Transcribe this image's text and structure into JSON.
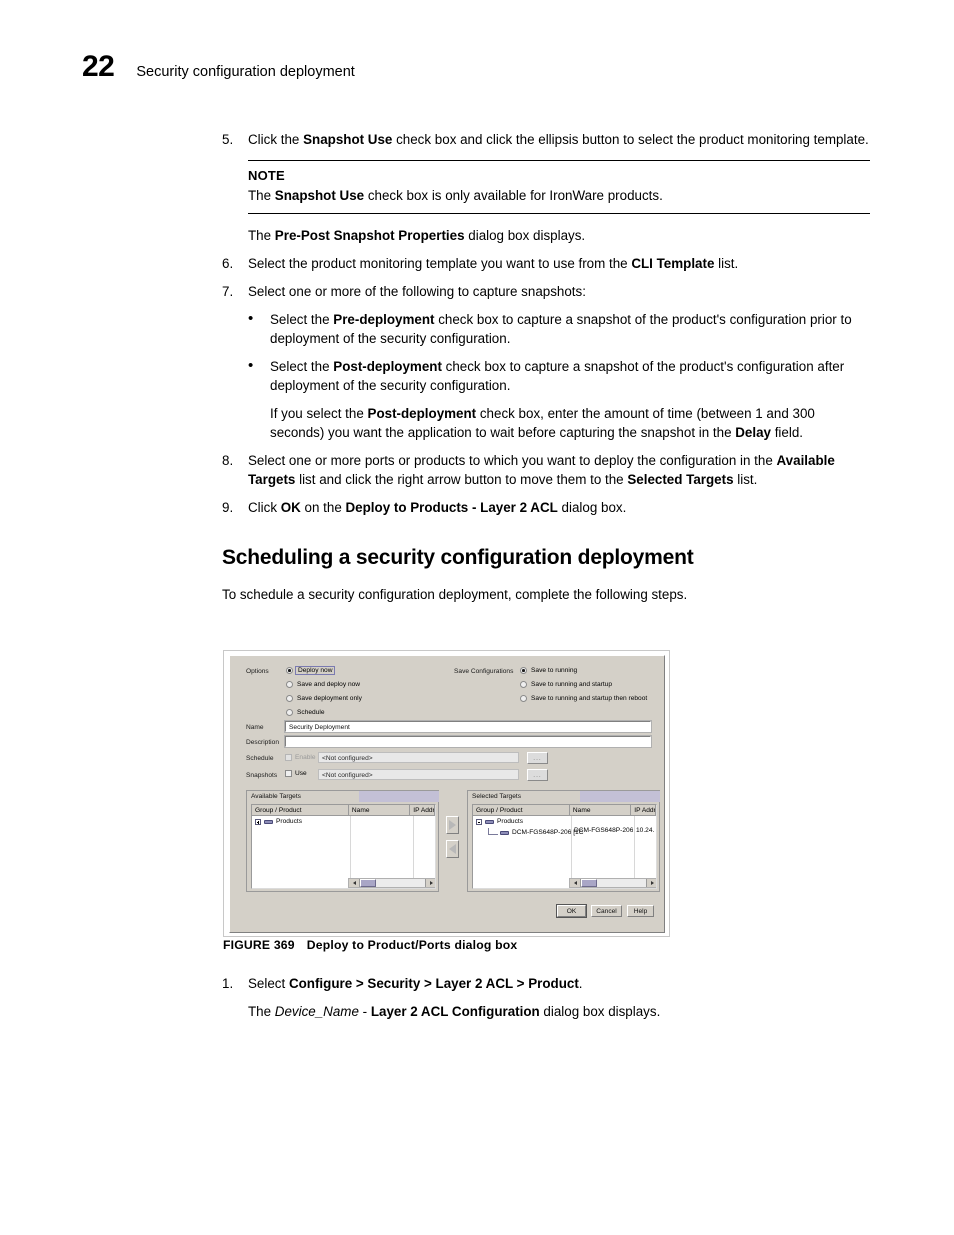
{
  "page": {
    "number": "22",
    "chapter_title": "Security configuration deployment"
  },
  "steps": [
    {
      "num": "5.",
      "text_parts": [
        "Click the ",
        "Snapshot Use",
        " check box and click the ellipsis button to select the product monitoring template."
      ]
    }
  ],
  "step5": {
    "num": "5.",
    "pre": "Click the ",
    "bold": "Snapshot Use",
    "post": " check box and click the ellipsis button to select the product monitoring template."
  },
  "note": {
    "title": "NOTE",
    "pre": "The ",
    "bold": "Snapshot Use",
    "post": " check box is only available for IronWare products."
  },
  "after_note": {
    "pre": "The ",
    "bold": "Pre-Post Snapshot Properties",
    "post": " dialog box displays."
  },
  "step6": {
    "num": "6.",
    "pre": "Select the product monitoring template you want to use from the ",
    "bold": "CLI Template",
    "post": " list."
  },
  "step7": {
    "num": "7.",
    "text": "Select one or more of the following to capture snapshots:"
  },
  "bullet1": {
    "dot": "•",
    "pre": "Select the ",
    "bold": "Pre-deployment",
    "post": " check box to capture a snapshot of the product's configuration prior to deployment of the security configuration."
  },
  "bullet2": {
    "dot": "•",
    "pre": "Select the ",
    "bold": "Post-deployment",
    "post": " check box to capture a snapshot of the product's configuration after deployment of the security configuration."
  },
  "bullet2_sub": {
    "pre": "If you select the ",
    "bold1": "Post-deployment",
    "mid": " check box, enter the amount of time (between 1 and 300 seconds) you want the application to wait before capturing the snapshot in the ",
    "bold2": "Delay",
    "post": " field."
  },
  "step8": {
    "num": "8.",
    "pre": "Select one or more ports or products to which you want to deploy the configuration in the ",
    "bold1": "Available Targets",
    "mid": " list and click the right arrow button to move them to the ",
    "bold2": "Selected Targets",
    "post": " list."
  },
  "step9": {
    "num": "9.",
    "pre": "Click ",
    "bold1": "OK",
    "mid": " on the ",
    "bold2": "Deploy to Products - Layer 2 ACL",
    "post": " dialog box."
  },
  "section": {
    "heading": "Scheduling a security configuration deployment",
    "intro": "To schedule a security configuration deployment, complete the following steps."
  },
  "figure": {
    "label": "FIGURE 369",
    "caption": "Deploy to Product/Ports dialog box"
  },
  "trailing_step1": {
    "num": "1.",
    "pre": "Select ",
    "bold": "Configure > Security > Layer 2 ACL > Product",
    "post": "."
  },
  "trailing_sub": {
    "pre": "The ",
    "italic": "Device_Name",
    "mid": " - ",
    "bold": "Layer 2 ACL Configuration",
    "post": " dialog box displays."
  },
  "dialog": {
    "options_label": "Options",
    "save_config_label": "Save Configurations",
    "options_radios": [
      {
        "label": "Deploy now",
        "selected": true,
        "focused": true
      },
      {
        "label": "Save and deploy now",
        "selected": false,
        "focused": false
      },
      {
        "label": "Save deployment only",
        "selected": false,
        "focused": false
      },
      {
        "label": "Schedule",
        "selected": false,
        "focused": false
      }
    ],
    "save_radios": [
      {
        "label": "Save to running",
        "selected": true
      },
      {
        "label": "Save to running and startup",
        "selected": false
      },
      {
        "label": "Save to running and startup then reboot",
        "selected": false
      }
    ],
    "name_label": "Name",
    "name_value": "Security Deployment",
    "description_label": "Description",
    "description_value": "",
    "schedule_label": "Schedule",
    "schedule_enable_label": "Enable",
    "schedule_value": "<Not configured>",
    "snapshots_label": "Snapshots",
    "snapshots_use_label": "Use",
    "snapshots_value": "<Not configured>",
    "ellipsis_label": "...",
    "available": {
      "title": "Available Targets",
      "columns": [
        "Group / Product",
        "Name",
        "IP Addr"
      ],
      "rows": [
        {
          "level": 0,
          "label": "Products",
          "name": "",
          "ip": ""
        }
      ]
    },
    "selected": {
      "title": "Selected Targets",
      "columns": [
        "Group / Product",
        "Name",
        "IP Addr"
      ],
      "rows": [
        {
          "level": 0,
          "label": "Products",
          "name": "",
          "ip": ""
        },
        {
          "level": 1,
          "label": "DCM-FGS648P-206 [1C",
          "name": "DCM-FGS648P-206",
          "ip": "10.24."
        }
      ]
    },
    "move_right_label": "▶",
    "move_left_label": "◀",
    "buttons": [
      "OK",
      "Cancel",
      "Help"
    ]
  },
  "colors": {
    "dialog_face": "#d4d0c8",
    "panel_header": "#c3c0d6",
    "scroll_thumb": "#a9a6c6",
    "focus_border": "#7a7ab0"
  }
}
